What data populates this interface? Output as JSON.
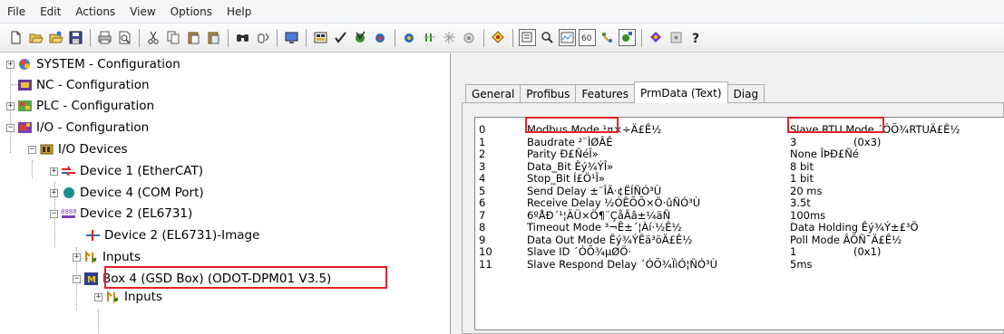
{
  "menu": [
    "File",
    "Edit",
    "Actions",
    "View",
    "Options",
    "Help"
  ],
  "toolbar_icons": [
    "new-file-icon",
    "open-file-icon",
    "open-project-icon",
    "save-icon",
    "sep",
    "print-icon",
    "print-preview-icon",
    "sep",
    "cut-icon",
    "copy-icon",
    "paste-icon",
    "paste-special-icon",
    "sep",
    "find-icon",
    "find-next-icon",
    "sep",
    "activate-config-icon",
    "sep",
    "generate-mappings-icon",
    "check-config-icon",
    "activate-icon",
    "restart-icon",
    "sep",
    "login-icon",
    "toggle-freerun-icon",
    "scan-icon",
    "show-online-icon",
    "sep",
    "select-target-icon",
    "sep",
    "toggle-grid-icon",
    "zoom-icon",
    "scope-icon",
    "watch-icon",
    "nc-icon",
    "io-icon",
    "sep",
    "library-icon",
    "info-icon",
    "help-icon"
  ],
  "tree": {
    "system": "SYSTEM - Configuration",
    "nc": "NC - Configuration",
    "plc": "PLC - Configuration",
    "io": "I/O - Configuration",
    "io_devices": "I/O Devices",
    "device1": "Device 1 (EtherCAT)",
    "device4": "Device 4 (COM Port)",
    "device2": "Device 2 (EL6731)",
    "device2_image": "Device 2 (EL6731)-Image",
    "inputs": "Inputs",
    "box4": "Box 4 (GSD Box) (ODOT-DPM01 V3.5)",
    "box_inputs": "Inputs"
  },
  "tabs": [
    "General",
    "Profibus",
    "Features",
    "PrmData (Text)",
    "Diag"
  ],
  "active_tab": "PrmData (Text)",
  "prm_rows": [
    {
      "idx": "0",
      "name": "Modbus Mode ¹¤×÷Ä£Ê½",
      "value": "Slave RTU Mode ´ÓÕ¾RTUÄ£Ê½",
      "hex": ""
    },
    {
      "idx": "1",
      "name": "Baudrate ²¨ÌØÂÊ",
      "value": "3",
      "hex": "(0x3)"
    },
    {
      "idx": "2",
      "name": "Parity Ð£ÑéÎ»",
      "value": "None ÎÞÐ£Ñé",
      "hex": ""
    },
    {
      "idx": "3",
      "name": "Data_Bit Êý¾ÝÎ»",
      "value": "8 bit",
      "hex": ""
    },
    {
      "idx": "4",
      "name": "Stop_Bit Í£Ö¹Î»",
      "value": "1 bit",
      "hex": ""
    },
    {
      "idx": "5",
      "name": "Send Delay ±¨ÎÄ·¢ËÍÑÓ³Ù",
      "value": "20 ms",
      "hex": ""
    },
    {
      "idx": "6",
      "name": "Receive Delay ½ÓÊÕÕ×Ö·ûÑÓ³Ù",
      "value": "3.5t",
      "hex": ""
    },
    {
      "idx": "7",
      "name": "6ºÅÐ´¹¦ÄÜ×Ö¶¨ÇåÃâ±¼äÑ",
      "value": "100ms",
      "hex": ""
    },
    {
      "idx": "8",
      "name": "Timeout Mode ³¬Ê±´¦Àí·½Ê½",
      "value": "Data Holding Êý¾Ý±£³Ö",
      "hex": ""
    },
    {
      "idx": "9",
      "name": "Data Out Mode Êý¾ÝÊä³öÄ£Ê½",
      "value": "Poll Mode ÂÖÑ¯Ä£Ê½",
      "hex": ""
    },
    {
      "idx": "10",
      "name": "Slave ID ´ÓÕ¾µØÖ·",
      "value": "1",
      "hex": "(0x1)"
    },
    {
      "idx": "11",
      "name": "Slave Respond Delay ´ÓÕ¾ÏìÓ¦ÑÓ³Ù",
      "value": "5ms",
      "hex": ""
    }
  ],
  "colors": {
    "highlight_border": "#e8202a",
    "window_bg": "#f0f0f0"
  }
}
